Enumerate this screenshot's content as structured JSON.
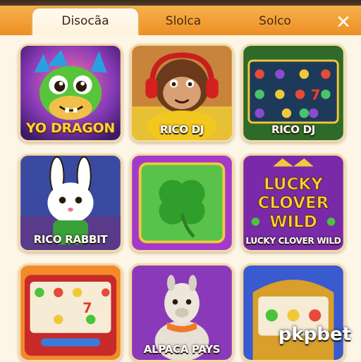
{
  "tabs": [
    {
      "label": "Disocãa",
      "active": true
    },
    {
      "label": "Slolca",
      "active": false
    },
    {
      "label": "Solco",
      "active": false
    }
  ],
  "close_icon": "✕",
  "games": [
    {
      "title": "YO DRAGON",
      "icon": "dragon"
    },
    {
      "title": "RICO DJ",
      "icon": "monkey-dj"
    },
    {
      "title": "RICO DJ",
      "icon": "slot-reels"
    },
    {
      "title": "RICO RABBIT",
      "icon": "rabbit"
    },
    {
      "title": "",
      "icon": "clover"
    },
    {
      "title": "LUCKY CLOVER WILD",
      "icon": "lucky-clover-wild",
      "logo_text": [
        "LUCKY",
        "CLOVER",
        "WILD"
      ]
    },
    {
      "title": "",
      "icon": "slot-machine"
    },
    {
      "title": "ALPACA PAYS",
      "icon": "alpaca"
    },
    {
      "title": "",
      "icon": "slot-machine-gold"
    }
  ],
  "watermark": "pkpbet",
  "colors": {
    "tabbar": "#ec8f25",
    "tab_active": "#fff1d8",
    "panel": "#fdf6e6",
    "label_gold": "#ffd23a"
  }
}
